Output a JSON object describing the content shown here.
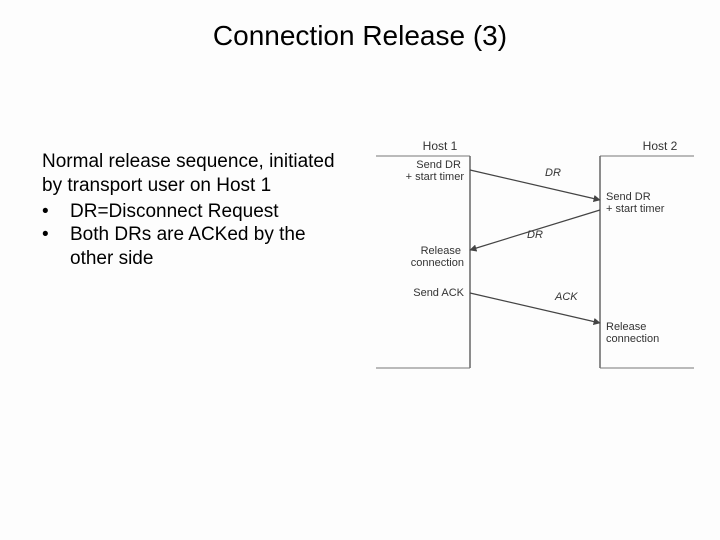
{
  "title": "Connection Release (3)",
  "paragraph": "Normal release sequence, initiated by transport user on Host 1",
  "bullets": [
    "DR=Disconnect Request",
    "Both DRs are ACKed by the other side"
  ],
  "diagram": {
    "host1": "Host 1",
    "host2": "Host 2",
    "left_events": [
      "Send DR\n+ start timer",
      "Release\nconnection",
      "Send ACK"
    ],
    "right_events": [
      "Send DR\n+ start timer",
      "Release\nconnection"
    ],
    "messages": [
      "DR",
      "DR",
      "ACK"
    ]
  }
}
